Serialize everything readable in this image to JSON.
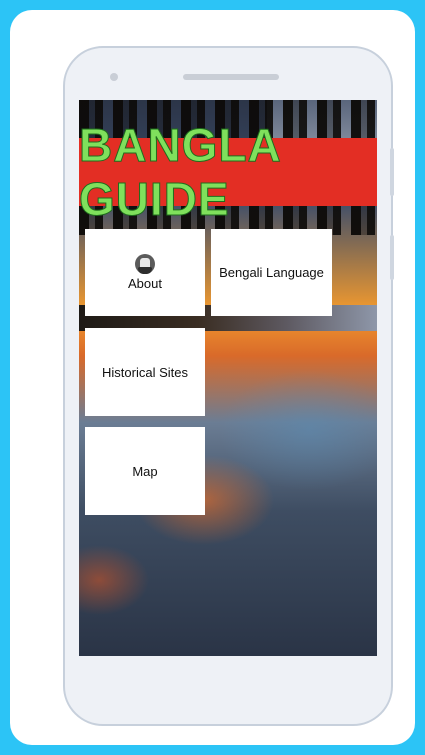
{
  "app": {
    "banner_title": "BANGLA GUIDE"
  },
  "menu": {
    "items": [
      {
        "label": "About",
        "icon": "avatar-icon"
      },
      {
        "label": "Bengali Language"
      },
      {
        "label": "Historical Sites"
      },
      {
        "label": "Map"
      }
    ]
  },
  "colors": {
    "page_background": "#2cc4f6",
    "banner_background": "#e32e24",
    "banner_text": "#7fe05c",
    "tile_background": "#ffffff"
  }
}
